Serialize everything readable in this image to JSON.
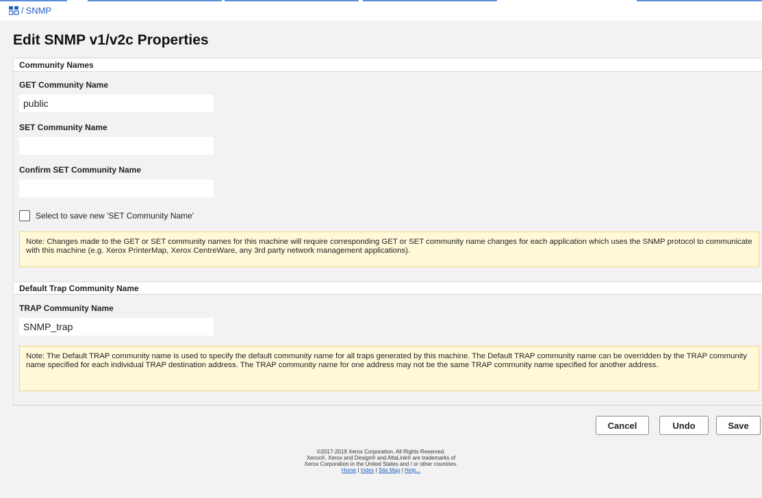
{
  "breadcrumb": {
    "separator": "/",
    "current": "SNMP"
  },
  "page": {
    "title": "Edit SNMP v1/v2c Properties"
  },
  "community_names": {
    "section_title": "Community Names",
    "get_label": "GET Community Name",
    "get_value": "public",
    "set_label": "SET Community Name",
    "set_value": "",
    "confirm_label": "Confirm SET Community Name",
    "confirm_value": "",
    "checkbox_label": "Select to save new 'SET Community Name'",
    "checkbox_checked": false,
    "note": "Note: Changes made to the GET or SET community names for this machine will require corresponding GET or SET community name changes for each application which uses the SNMP protocol to communicate with this machine (e.g. Xerox PrinterMap, Xerox CentreWare, any 3rd party network management applications)."
  },
  "trap": {
    "section_title": "Default Trap Community Name",
    "trap_label": "TRAP Community Name",
    "trap_value": "SNMP_trap",
    "note": "Note: The Default TRAP community name is used to specify the default community name for all traps generated by this machine. The Default TRAP community name can be overridden by the TRAP community name specified for each individual TRAP destination address. The TRAP community name for one address may not be the same TRAP community name specified for another address."
  },
  "buttons": {
    "cancel": "Cancel",
    "undo": "Undo",
    "save": "Save"
  },
  "footer": {
    "line1": "©2017-2019  Xerox Corporation. All Rights Reserved.",
    "line2": "Xerox®, Xerox and Design® and AltaLink® are trademarks of",
    "line3": "Xerox Corporation in the United States and / or other countries.",
    "links": {
      "home": "Home",
      "index": "Index",
      "site_map": "Site Map",
      "help": "Help..."
    },
    "link_separator": "|"
  },
  "colors": {
    "link": "#1f5fbf",
    "note_bg": "#fff9d9",
    "note_border": "#f0d880",
    "page_bg": "#f2f2f2"
  }
}
